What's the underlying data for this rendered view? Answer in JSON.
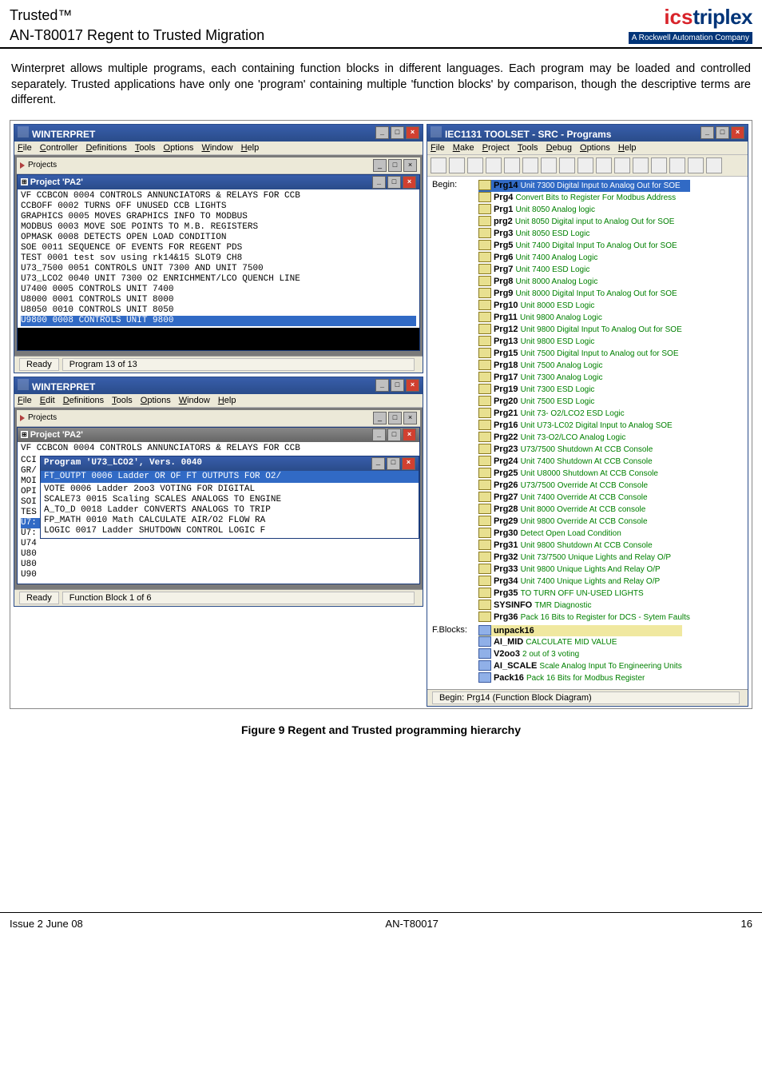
{
  "doc": {
    "brand": "Trusted™",
    "subtitle": "AN-T80017 Regent to Trusted Migration",
    "logo_ics": "ics",
    "logo_triplex": "triplex",
    "logo_sub": "A Rockwell Automation Company",
    "paragraph": "Winterpret allows multiple programs, each containing function blocks in different languages. Each program may be loaded and controlled separately. Trusted applications have only one 'program' containing multiple 'function blocks' by comparison, though the descriptive terms are different.",
    "caption": "Figure 9 Regent and Trusted programming hierarchy",
    "footer_left": "Issue 2 June 08",
    "footer_mid": "AN-T80017",
    "footer_right": "16"
  },
  "win1": {
    "title": "WINTERPRET",
    "menu": [
      "File",
      "Controller",
      "Definitions",
      "Tools",
      "Options",
      "Window",
      "Help"
    ],
    "projects_label": "Projects",
    "project_title": "Project 'PA2'",
    "status_ready": "Ready",
    "status_prog": "Program 13 of 13",
    "rows": [
      [
        "VF",
        "CCBCON",
        "0004",
        "CONTROLS ANNUNCIATORS & RELAYS FOR CCB"
      ],
      [
        "",
        "CCBOFF",
        "0002",
        "TURNS OFF UNUSED CCB LIGHTS"
      ],
      [
        "",
        "GRAPHICS",
        "0005",
        "MOVES GRAPHICS INFO TO MODBUS"
      ],
      [
        "",
        "MODBUS",
        "0003",
        "MOVE SOE POINTS TO M.B. REGISTERS"
      ],
      [
        "",
        "OPMASK",
        "0008",
        "DETECTS OPEN LOAD CONDITION"
      ],
      [
        "",
        "SOE",
        "0011",
        "SEQUENCE OF EVENTS FOR REGENT PDS"
      ],
      [
        "",
        "TEST",
        "0001",
        "test sov using rk14&15 SLOT9 CH8"
      ],
      [
        "",
        "U73_7500",
        "0051",
        "CONTROLS UNIT 7300 AND UNIT 7500"
      ],
      [
        "",
        "U73_LCO2",
        "0040",
        "UNIT 7300 O2 ENRICHMENT/LCO QUENCH LINE"
      ],
      [
        "",
        "U7400",
        "0005",
        "CONTROLS UNIT 7400"
      ],
      [
        "",
        "U8000",
        "0001",
        "CONTROLS UNIT 8000"
      ],
      [
        "",
        "U8050",
        "0010",
        "CONTROLS UNIT 8050"
      ],
      [
        "",
        "U9800",
        "0008",
        "CONTROLS UNIT 9800"
      ]
    ],
    "selected_index": 12
  },
  "win2": {
    "title": "WINTERPRET",
    "menu": [
      "File",
      "Edit",
      "Definitions",
      "Tools",
      "Options",
      "Window",
      "Help"
    ],
    "projects_label": "Projects",
    "project_title": "Project 'PA2'",
    "top_row": [
      "VF",
      "CCBCON",
      "0004",
      "CONTROLS ANNUNCIATORS & RELAYS FOR CCB"
    ],
    "inner_title": "Program 'U73_LCO2', Vers. 0040",
    "inner_header": [
      "FT_OUTPT",
      "0006",
      "Ladder",
      "OR OF FT OUTPUTS FOR O2/"
    ],
    "inner_rows": [
      [
        "VOTE",
        "0006",
        "Ladder",
        "2oo3 VOTING FOR DIGITAL"
      ],
      [
        "SCALE73",
        "0015",
        "Scaling",
        "SCALES ANALOGS TO ENGINE"
      ],
      [
        "A_TO_D",
        "0018",
        "Ladder",
        "CONVERTS ANALOGS TO TRIP"
      ],
      [
        "FP_MATH",
        "0010",
        "Math",
        "CALCULATE AIR/O2 FLOW RA"
      ],
      [
        "LOGIC",
        "0017",
        "Ladder",
        "SHUTDOWN CONTROL LOGIC F"
      ]
    ],
    "left_prefixes": [
      "CCI",
      "GR/",
      "MOI",
      "OPI",
      "SOI",
      "TES",
      "U7:",
      "U7:",
      "U74",
      "U80",
      "U80",
      "U90"
    ],
    "status_ready": "Ready",
    "status_fb": "Function Block 1 of 6"
  },
  "iec": {
    "title": "IEC1131 TOOLSET - SRC - Programs",
    "menu": [
      "File",
      "Make",
      "Project",
      "Tools",
      "Debug",
      "Options",
      "Help"
    ],
    "begin_label": "Begin:",
    "fblocks_label": "F.Blocks:",
    "begin_footer": "Begin:  Prg14  (Function Block Diagram)",
    "programs": [
      {
        "n": "Prg14",
        "d": "Unit 7300 Digital Input to Analog Out for SOE",
        "hl": true
      },
      {
        "n": "Prg4",
        "d": "Convert Bits to Register For Modbus Address"
      },
      {
        "n": "Prg1",
        "d": "Unit 8050 Analog logic"
      },
      {
        "n": "prg2",
        "d": "Unit 8050 Digital input to Analog Out for SOE"
      },
      {
        "n": "Prg3",
        "d": "Unit 8050 ESD Logic"
      },
      {
        "n": "Prg5",
        "d": "Unit 7400 Digital Input To Analog Out for SOE"
      },
      {
        "n": "Prg6",
        "d": "Unit 7400 Analog Logic"
      },
      {
        "n": "Prg7",
        "d": "Unit 7400 ESD Logic"
      },
      {
        "n": "Prg8",
        "d": "Unit 8000 Analog Logic"
      },
      {
        "n": "Prg9",
        "d": "Unit 8000 Digital Input To Analog Out for SOE"
      },
      {
        "n": "Prg10",
        "d": "Unit 8000 ESD Logic"
      },
      {
        "n": "Prg11",
        "d": "Unit 9800 Analog Logic"
      },
      {
        "n": "Prg12",
        "d": "Unit 9800 Digital Input To Analog Out for SOE"
      },
      {
        "n": "Prg13",
        "d": "Unit 9800 ESD Logic"
      },
      {
        "n": "Prg15",
        "d": "Unit 7500 Digital Input to Analog out for SOE"
      },
      {
        "n": "Prg18",
        "d": "Unit 7500 Analog Logic"
      },
      {
        "n": "Prg17",
        "d": "Unit 7300 Analog Logic"
      },
      {
        "n": "Prg19",
        "d": "Unit 7300 ESD Logic"
      },
      {
        "n": "Prg20",
        "d": "Unit 7500 ESD Logic"
      },
      {
        "n": "Prg21",
        "d": "Unit 73- O2/LCO2 ESD Logic"
      },
      {
        "n": "Prg16",
        "d": "Unit U73-LC02 Digital Input to Analog SOE"
      },
      {
        "n": "Prg22",
        "d": "Unit 73-O2/LCO Analog Logic"
      },
      {
        "n": "Prg23",
        "d": "U73/7500 Shutdown At CCB Console"
      },
      {
        "n": "Prg24",
        "d": "Unit 7400 Shutdown At CCB Console"
      },
      {
        "n": "Prg25",
        "d": "Unit U8000 Shutdown At CCB Console"
      },
      {
        "n": "Prg26",
        "d": "U73/7500 Override At CCB Console"
      },
      {
        "n": "Prg27",
        "d": "Unit 7400 Override At CCB Console"
      },
      {
        "n": "Prg28",
        "d": "Unit 8000 Override At CCB console"
      },
      {
        "n": "Prg29",
        "d": "Unit 9800 Override At CCB Console"
      },
      {
        "n": "Prg30",
        "d": "Detect Open Load Condition"
      },
      {
        "n": "Prg31",
        "d": "Unit 9800 Shutdown At CCB Console"
      },
      {
        "n": "Prg32",
        "d": "Unit 73/7500 Unique Lights and Relay O/P"
      },
      {
        "n": "Prg33",
        "d": "Unit 9800 Unique Lights And Relay O/P"
      },
      {
        "n": "Prg34",
        "d": "Unit 7400 Unique Lights and Relay O/P"
      },
      {
        "n": "Prg35",
        "d": "TO TURN OFF UN-USED LIGHTS"
      },
      {
        "n": "SYSINFO",
        "d": "TMR Diagnostic"
      },
      {
        "n": "Prg36",
        "d": "Pack 16 Bits to Register for DCS - Sytem Faults"
      }
    ],
    "fblocks": [
      {
        "n": "unpack16",
        "d": ""
      },
      {
        "n": "AI_MID",
        "d": "CALCULATE MID VALUE"
      },
      {
        "n": "V2oo3",
        "d": "2 out of 3 voting"
      },
      {
        "n": "AI_SCALE",
        "d": "Scale Analog Input To Engineering Units"
      },
      {
        "n": "Pack16",
        "d": "Pack 16 Bits for Modbus Register"
      }
    ]
  }
}
